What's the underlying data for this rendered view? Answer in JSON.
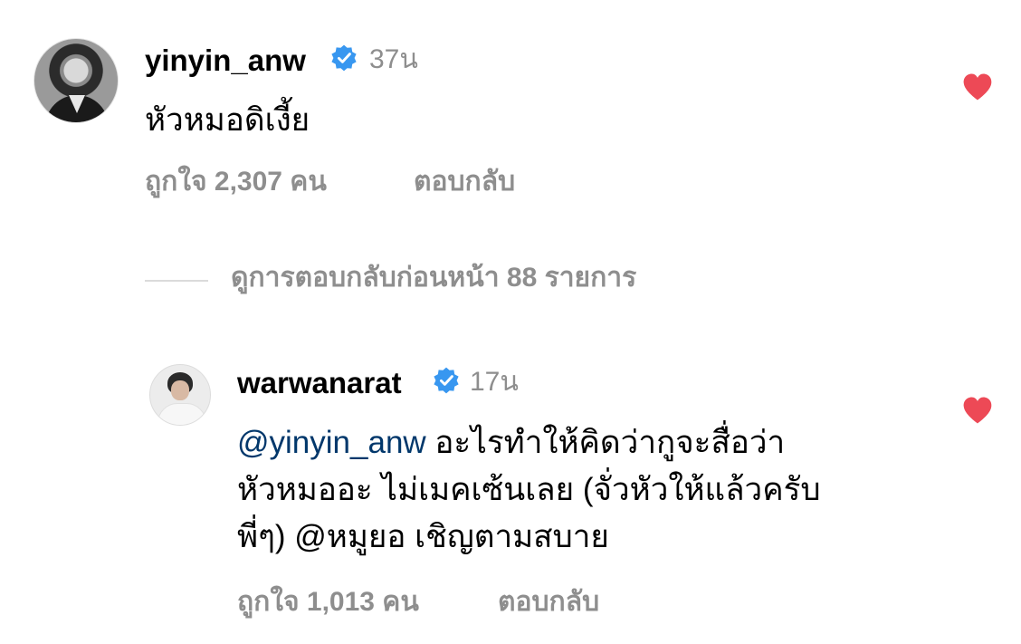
{
  "comments": [
    {
      "username": "yinyin_anw",
      "verified": true,
      "time": "37น",
      "text": "หัวหมอดิเงี้ย",
      "likes": "ถูกใจ 2,307 คน",
      "reply": "ตอบกลับ",
      "liked": true
    },
    {
      "username": "warwanarat",
      "verified": true,
      "time": "17น",
      "mention": "@yinyin_anw",
      "text_line1": " อะไรทำให้คิดว่ากูจะสื่อว่า",
      "text_line2": "หัวหมออะ ไม่เมคเซ้นเลย (จั่วหัวให้แล้วครับ",
      "text_line3": "พี่ๆ) @หมูยอ เชิญตามสบาย",
      "likes": "ถูกใจ 1,013 คน",
      "reply": "ตอบกลับ",
      "liked": true
    }
  ],
  "view_replies": "ดูการตอบกลับก่อนหน้า 88 รายการ",
  "colors": {
    "heart": "#ed4956",
    "verified": "#3897f0",
    "secondary_text": "#8e8e8e",
    "mention": "#00376b"
  },
  "icons": {
    "verified": "verified-badge-icon",
    "heart": "heart-filled-icon"
  }
}
